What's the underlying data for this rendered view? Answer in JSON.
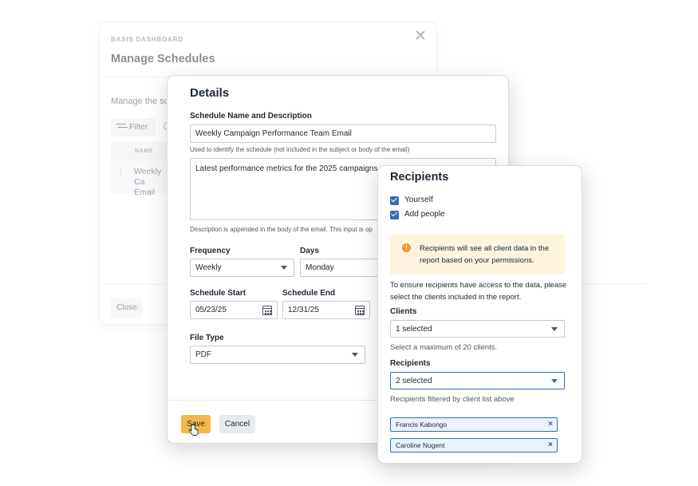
{
  "background_modal": {
    "eyebrow": "BASIS DASHBOARD",
    "close_icon": "✕",
    "title": "Manage Schedules",
    "subtitle": "Manage the sc",
    "filter_label": "Filter",
    "table_header": "NAME",
    "row_text_line1": "Weekly Ca",
    "row_text_line2": "Email",
    "close_button": "Close"
  },
  "details": {
    "title": "Details",
    "name_label": "Schedule Name and Description",
    "name_value": "Weekly Campaign Performance Team Email",
    "name_help": "Used to identify the schedule (not included in the subject or body of the email)",
    "description_value": "Latest performance metrics for the 2025 campaigns",
    "description_help": "Description is appended in the body of the email. This input is op",
    "frequency_label": "Frequency",
    "frequency_value": "Weekly",
    "days_label": "Days",
    "days_value": "Monday",
    "start_label": "Schedule Start",
    "start_value": "05/23/25",
    "end_label": "Schedule End",
    "end_value": "12/31/25",
    "filetype_label": "File Type",
    "filetype_value": "PDF",
    "save_label": "Save",
    "cancel_label": "Cancel"
  },
  "recipients": {
    "title": "Recipients",
    "checkbox_yourself": "Yourself",
    "checkbox_add_people": "Add people",
    "warning_icon": "!",
    "warning_text": "Recipients will see all client data in the report based on your permissions.",
    "instructions": "To ensure recipients have access to the data, please select the clients included in the report.",
    "clients_label": "Clients",
    "clients_value": "1 selected",
    "clients_help": "Select a maximum of 20 clients.",
    "recipients_label": "Recipients",
    "recipients_value": "2 selected",
    "recipients_help": "Recipients filtered by client list above",
    "chips": [
      {
        "name": "Francis Kabongo",
        "remove": "×"
      },
      {
        "name": "Caroline Nugent",
        "remove": "×"
      }
    ]
  },
  "colors": {
    "accent_blue": "#2f6fb3",
    "save_yellow": "#f3b845",
    "warning_bg": "#fdf3de",
    "warning_icon": "#ec9a2e"
  }
}
